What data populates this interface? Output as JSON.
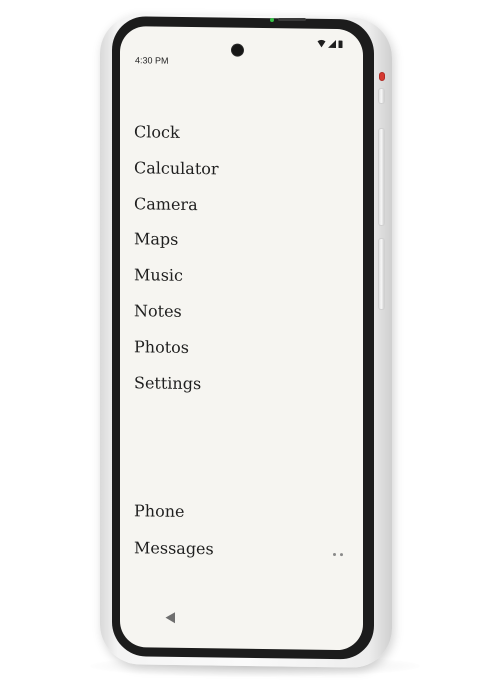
{
  "status_bar": {
    "time": "4:30 PM",
    "icons": [
      "wifi-icon",
      "signal-icon",
      "battery-icon"
    ]
  },
  "apps": [
    {
      "label": "Clock"
    },
    {
      "label": "Calculator"
    },
    {
      "label": "Camera"
    },
    {
      "label": "Maps"
    },
    {
      "label": "Music"
    },
    {
      "label": "Notes"
    },
    {
      "label": "Photos"
    },
    {
      "label": "Settings"
    }
  ],
  "dock": [
    {
      "label": "Phone"
    },
    {
      "label": "Messages"
    }
  ],
  "pager": {
    "pages": 2
  },
  "navigation": {
    "back_icon": "back-triangle-icon"
  },
  "colors": {
    "screen_background": "#f6f5f1",
    "text": "#1f1f1f",
    "bezel": "#1c1c1c",
    "frame": "#f4f4f4",
    "power_accent": "#d63a32"
  }
}
